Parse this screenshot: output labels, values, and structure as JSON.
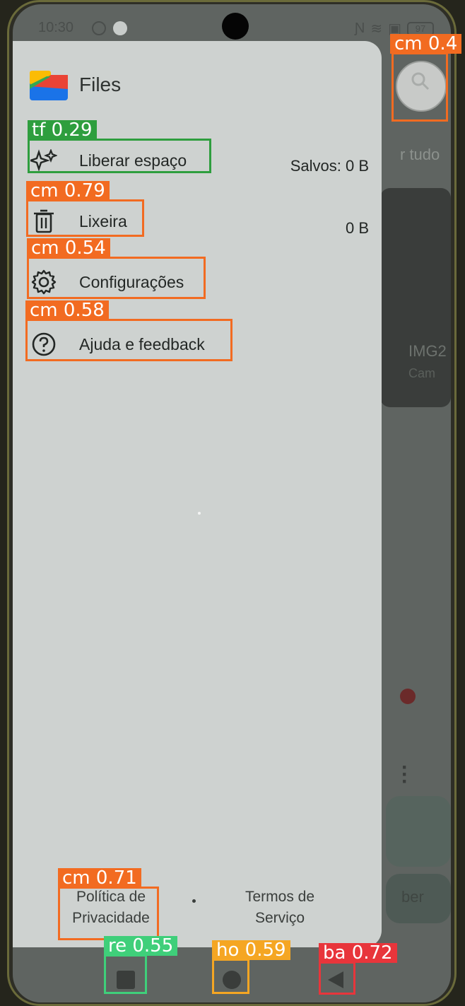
{
  "status_bar": {
    "time": "10:30",
    "battery": "97"
  },
  "drawer": {
    "app_title": "Files",
    "items": [
      {
        "label": "Liberar espaço",
        "value": "Salvos: 0 B",
        "icon": "sparkle-icon"
      },
      {
        "label": "Lixeira",
        "value": "0 B",
        "icon": "trash-icon"
      },
      {
        "label": "Configurações",
        "icon": "gear-icon"
      },
      {
        "label": "Ajuda e feedback",
        "icon": "help-icon"
      }
    ],
    "footer": {
      "privacy_line1": "Política de",
      "privacy_line2": "Privacidade",
      "terms_line1": "Termos de",
      "terms_line2": "Serviço"
    }
  },
  "background_app": {
    "text_tudo": "r tudo",
    "text_img": "IMG2",
    "text_cam": "Cam",
    "text_ber": "ber"
  },
  "detections": [
    {
      "label": "cm 0.4",
      "color": "#f26b21"
    },
    {
      "label": "tf 0.29",
      "color": "#2e9e3e"
    },
    {
      "label": "cm 0.79",
      "color": "#f26b21"
    },
    {
      "label": "cm 0.54",
      "color": "#f26b21"
    },
    {
      "label": "cm 0.58",
      "color": "#f26b21"
    },
    {
      "label": "cm 0.71",
      "color": "#f26b21"
    },
    {
      "label": "re 0.55",
      "color": "#3fcf7a"
    },
    {
      "label": "ho 0.59",
      "color": "#f5a623"
    },
    {
      "label": "ba 0.72",
      "color": "#e8353b"
    }
  ]
}
